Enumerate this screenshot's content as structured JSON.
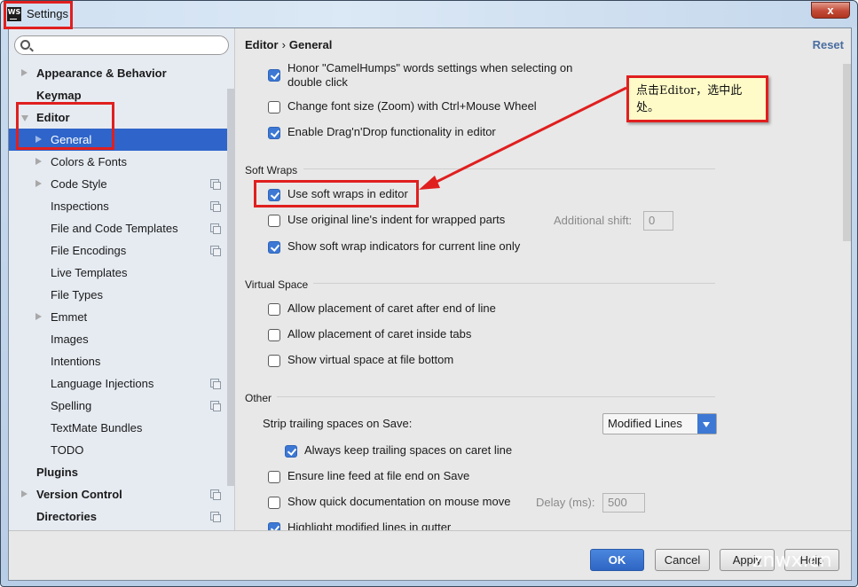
{
  "window": {
    "title": "Settings",
    "app_icon_text": "WS",
    "close_glyph": "x"
  },
  "sidebar": {
    "search_placeholder": "",
    "items": [
      {
        "label": "Appearance & Behavior",
        "level": 0,
        "arrow": "right",
        "copy_icon": false
      },
      {
        "label": "Keymap",
        "level": 0,
        "arrow": "none",
        "copy_icon": false
      },
      {
        "label": "Editor",
        "level": 0,
        "arrow": "down",
        "copy_icon": false
      },
      {
        "label": "General",
        "level": 1,
        "arrow": "right",
        "copy_icon": false,
        "selected": true
      },
      {
        "label": "Colors & Fonts",
        "level": 1,
        "arrow": "right",
        "copy_icon": false
      },
      {
        "label": "Code Style",
        "level": 1,
        "arrow": "right",
        "copy_icon": true
      },
      {
        "label": "Inspections",
        "level": 1,
        "arrow": "none",
        "copy_icon": true
      },
      {
        "label": "File and Code Templates",
        "level": 1,
        "arrow": "none",
        "copy_icon": true
      },
      {
        "label": "File Encodings",
        "level": 1,
        "arrow": "none",
        "copy_icon": true
      },
      {
        "label": "Live Templates",
        "level": 1,
        "arrow": "none",
        "copy_icon": false
      },
      {
        "label": "File Types",
        "level": 1,
        "arrow": "none",
        "copy_icon": false
      },
      {
        "label": "Emmet",
        "level": 1,
        "arrow": "right",
        "copy_icon": false
      },
      {
        "label": "Images",
        "level": 1,
        "arrow": "none",
        "copy_icon": false
      },
      {
        "label": "Intentions",
        "level": 1,
        "arrow": "none",
        "copy_icon": false
      },
      {
        "label": "Language Injections",
        "level": 1,
        "arrow": "none",
        "copy_icon": true
      },
      {
        "label": "Spelling",
        "level": 1,
        "arrow": "none",
        "copy_icon": true
      },
      {
        "label": "TextMate Bundles",
        "level": 1,
        "arrow": "none",
        "copy_icon": false
      },
      {
        "label": "TODO",
        "level": 1,
        "arrow": "none",
        "copy_icon": false
      },
      {
        "label": "Plugins",
        "level": 0,
        "arrow": "none",
        "copy_icon": false
      },
      {
        "label": "Version Control",
        "level": 0,
        "arrow": "right",
        "copy_icon": true
      },
      {
        "label": "Directories",
        "level": 0,
        "arrow": "none",
        "copy_icon": true
      }
    ]
  },
  "main": {
    "breadcrumb": {
      "parent": "Editor",
      "separator": "›",
      "current": "General"
    },
    "reset_label": "Reset",
    "top_options": [
      {
        "label_line1": "Honor \"CamelHumps\" words settings when selecting on",
        "label_line2": "double click",
        "checked": true
      },
      {
        "label": "Change font size (Zoom) with Ctrl+Mouse Wheel",
        "checked": false
      },
      {
        "label": "Enable Drag'n'Drop functionality in editor",
        "checked": true
      }
    ],
    "soft_wraps": {
      "title": "Soft Wraps",
      "options": [
        {
          "label": "Use soft wraps in editor",
          "checked": true
        },
        {
          "label": "Use original line's indent for wrapped parts",
          "checked": false
        },
        {
          "label": "Show soft wrap indicators for current line only",
          "checked": true
        }
      ],
      "additional_shift_label": "Additional shift:",
      "additional_shift_value": "0"
    },
    "virtual_space": {
      "title": "Virtual Space",
      "options": [
        {
          "label": "Allow placement of caret after end of line",
          "checked": false
        },
        {
          "label": "Allow placement of caret inside tabs",
          "checked": false
        },
        {
          "label": "Show virtual space at file bottom",
          "checked": false
        }
      ]
    },
    "other": {
      "title": "Other",
      "strip_label": "Strip trailing spaces on Save:",
      "strip_value": "Modified Lines",
      "options": [
        {
          "label": "Always keep trailing spaces on caret line",
          "checked": true
        },
        {
          "label": "Ensure line feed at file end on Save",
          "checked": false
        },
        {
          "label": "Show quick documentation on mouse move",
          "checked": false
        },
        {
          "label": "Highlight modified lines in gutter",
          "checked": true
        }
      ],
      "delay_label": "Delay (ms):",
      "delay_value": "500"
    }
  },
  "footer": {
    "ok_label": "OK",
    "cancel_label": "Cancel",
    "apply_label": "Apply",
    "help_label": "Help"
  },
  "annotation": {
    "callout_text": "点击Editor，选中此处。",
    "color": "#e01f1f"
  },
  "watermark": "znwx.cn",
  "colors": {
    "accent": "#2f65ca",
    "checkbox": "#3d78d4",
    "link": "#4a6ea0"
  }
}
